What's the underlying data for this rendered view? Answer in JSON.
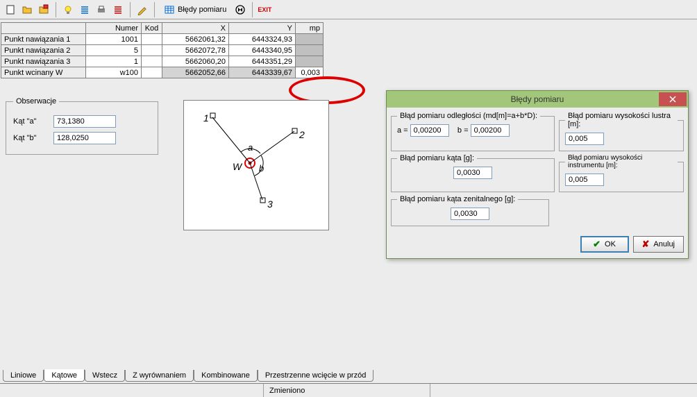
{
  "toolbar": {
    "icons": [
      "new-file-icon",
      "open-folder-icon",
      "save-icon",
      "bulb-icon",
      "lines-icon",
      "print-icon",
      "red-lines-icon",
      "pencil-icon",
      "table-icon"
    ],
    "bledy_label": "Błędy pomiaru",
    "exit_label": "EXIT"
  },
  "table": {
    "headers": {
      "numer": "Numer",
      "kod": "Kod",
      "x": "X",
      "y": "Y",
      "mp": "mp"
    },
    "rows": [
      {
        "label": "Punkt nawiązania 1",
        "numer": "1001",
        "kod": "",
        "x": "5662061,32",
        "y": "6443324,93",
        "mp": ""
      },
      {
        "label": "Punkt nawiązania 2",
        "numer": "5",
        "kod": "",
        "x": "5662072,78",
        "y": "6443340,95",
        "mp": ""
      },
      {
        "label": "Punkt nawiązania 3",
        "numer": "1",
        "kod": "",
        "x": "5662060,20",
        "y": "6443351,29",
        "mp": ""
      },
      {
        "label": "Punkt wcinany W",
        "numer": "w100",
        "kod": "",
        "x": "5662052,66",
        "y": "6443339,67",
        "mp": "0,003",
        "result": true
      }
    ]
  },
  "obs": {
    "legend": "Obserwacje",
    "a_label": "Kąt \"a\"",
    "a_value": "73,1380",
    "b_label": "Kąt \"b\"",
    "b_value": "128,0250"
  },
  "dialog": {
    "title": "Błędy pomiaru",
    "dist_legend": "Błąd pomiaru odległości (md[m]=a+b*D):",
    "a_label": "a =",
    "a_value": "0,00200",
    "b_label": "b =",
    "b_value": "0,00200",
    "mirror_legend": "Błąd pomiaru wysokości lustra [m]:",
    "mirror_value": "0,005",
    "angle_legend": "Błąd pomiaru kąta [g]:",
    "angle_value": "0,0030",
    "instr_legend": "Błąd pomiaru wysokości instrumentu [m]:",
    "instr_value": "0,005",
    "zenith_legend": "Błąd pomiaru kąta zenitalnego [g]:",
    "zenith_value": "0,0030",
    "ok_label": "OK",
    "cancel_label": "Anuluj"
  },
  "tabs": {
    "items": [
      "Liniowe",
      "Kątowe",
      "Wstecz",
      "Z wyrównaniem",
      "Kombinowane",
      "Przestrzenne wcięcie w przód"
    ],
    "active": 1
  },
  "status": {
    "text": "Zmieniono"
  }
}
